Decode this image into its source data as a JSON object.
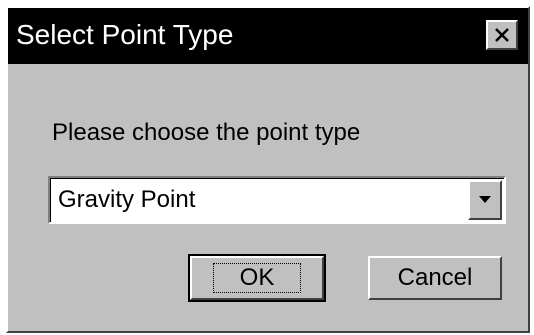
{
  "window": {
    "title": "Select Point Type",
    "close_icon": "close-icon"
  },
  "prompt": "Please choose the point type",
  "point_type_select": {
    "value": "Gravity Point",
    "arrow_icon": "chevron-down-icon"
  },
  "buttons": {
    "ok_label": "OK",
    "cancel_label": "Cancel"
  },
  "colors": {
    "title_bar": "#000000",
    "dialog_face": "#c0c0c0",
    "field_background": "#ffffff"
  }
}
